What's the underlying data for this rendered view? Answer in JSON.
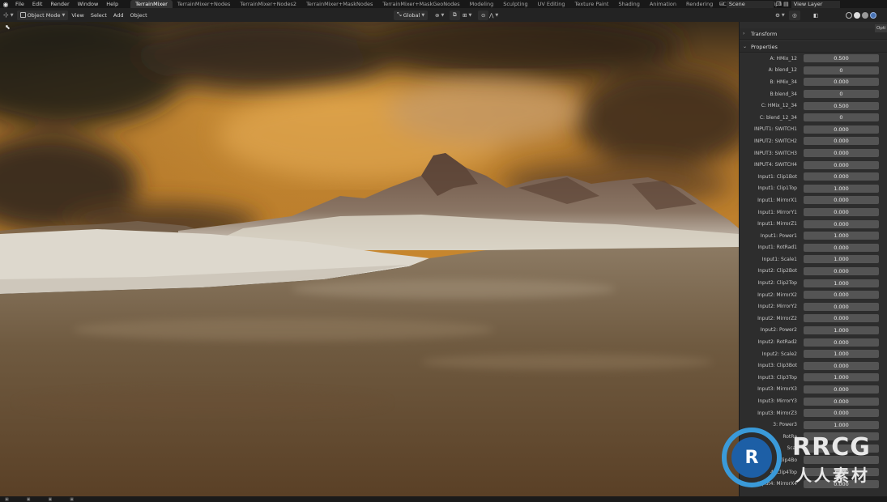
{
  "topbar": {
    "menus": [
      "File",
      "Edit",
      "Render",
      "Window",
      "Help"
    ],
    "workspaces": [
      "TerrainMixer",
      "TerrainMixer+Nodes",
      "TerrainMixer+Nodes2",
      "TerrainMixer+MaskNodes",
      "TerrainMixer+MaskGeoNodes",
      "Modeling",
      "Sculpting",
      "UV Editing",
      "Texture Paint",
      "Shading",
      "Animation",
      "Rendering",
      "Compositing",
      "Scripti"
    ],
    "active_workspace": "TerrainMixer",
    "scene": "Scene",
    "view_layer": "View Layer"
  },
  "viewport_header": {
    "mode": "Object Mode",
    "menus": [
      "View",
      "Select",
      "Add",
      "Object"
    ],
    "orientation": "Global"
  },
  "sidebar": {
    "option_tab": "Opti",
    "transform_label": "Transform",
    "properties_label": "Properties",
    "properties": [
      {
        "label": "A: HMix_12",
        "value": "0.500"
      },
      {
        "label": "A: blend_12",
        "value": "0"
      },
      {
        "label": "B: HMix_34",
        "value": "0.000"
      },
      {
        "label": "B:blend_34",
        "value": "0"
      },
      {
        "label": "C: HMix_12_34",
        "value": "0.500"
      },
      {
        "label": "C: blend_12_34",
        "value": "0"
      },
      {
        "label": "INPUT1: SWITCH1",
        "value": "0.000"
      },
      {
        "label": "INPUT2: SWITCH2",
        "value": "0.000"
      },
      {
        "label": "INPUT3: SWITCH3",
        "value": "0.000"
      },
      {
        "label": "INPUT4: SWITCH4",
        "value": "0.000"
      },
      {
        "label": "Input1: Clip1Bot",
        "value": "0.000"
      },
      {
        "label": "Input1: Clip1Top",
        "value": "1.000"
      },
      {
        "label": "Input1: MirrorX1",
        "value": "0.000"
      },
      {
        "label": "Input1: MirrorY1",
        "value": "0.000"
      },
      {
        "label": "Input1: MirrorZ1",
        "value": "0.000"
      },
      {
        "label": "Input1: Power1",
        "value": "1.000"
      },
      {
        "label": "Input1: RotRad1",
        "value": "0.000"
      },
      {
        "label": "Input1: Scale1",
        "value": "1.000"
      },
      {
        "label": "Input2: Clip2Bot",
        "value": "0.000"
      },
      {
        "label": "Input2: Clip2Top",
        "value": "1.000"
      },
      {
        "label": "Input2: MirrorX2",
        "value": "0.000"
      },
      {
        "label": "Input2: MirrorY2",
        "value": "0.000"
      },
      {
        "label": "Input2: MirrorZ2",
        "value": "0.000"
      },
      {
        "label": "Input2: Power2",
        "value": "1.000"
      },
      {
        "label": "Input2: RotRad2",
        "value": "0.000"
      },
      {
        "label": "Input2: Scale2",
        "value": "1.000"
      },
      {
        "label": "Input3: Clip3Bot",
        "value": "0.000"
      },
      {
        "label": "Input3: Clip3Top",
        "value": "1.000"
      },
      {
        "label": "Input3: MirrorX3",
        "value": "0.000"
      },
      {
        "label": "Input3: MirrorY3",
        "value": "0.000"
      },
      {
        "label": "Input3: MirrorZ3",
        "value": "0.000"
      },
      {
        "label": "3: Power3",
        "value": "1.000"
      },
      {
        "label": "RotRa",
        "value": ""
      },
      {
        "label": "Scal",
        "value": ""
      },
      {
        "label": "Clip4Bo",
        "value": ""
      },
      {
        "label": "4: Clip4Top",
        "value": "1.000"
      },
      {
        "label": "Input4: MirrorX4",
        "value": "0.000"
      }
    ]
  },
  "watermark": {
    "brand": "RRCG",
    "subtitle": "人人素材"
  },
  "colors": {
    "accent": "#4772b3",
    "sky": "#b57a2a",
    "water": "#7d6345"
  }
}
